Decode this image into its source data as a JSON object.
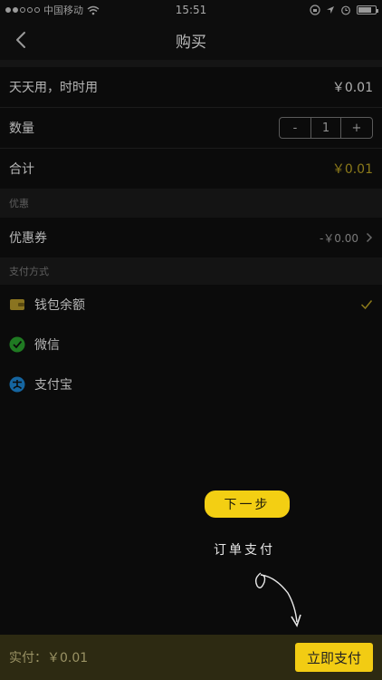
{
  "status_bar": {
    "carrier": "中国移动",
    "time": "15:51"
  },
  "nav": {
    "title": "购买"
  },
  "order": {
    "product_name": "天天用，时时用",
    "product_price": "￥0.01",
    "quantity_label": "数量",
    "quantity_minus": "-",
    "quantity_value": "1",
    "quantity_plus": "+",
    "total_label": "合计",
    "total_price": "￥0.01"
  },
  "discount": {
    "section_label": "优惠",
    "coupon_label": "优惠券",
    "coupon_value": "-￥0.00"
  },
  "payment": {
    "section_label": "支付方式",
    "methods": [
      {
        "label": "钱包余额",
        "icon": "wallet-icon",
        "selected": true
      },
      {
        "label": "微信",
        "icon": "wechat-icon",
        "selected": false
      },
      {
        "label": "支付宝",
        "icon": "alipay-icon",
        "selected": false
      }
    ]
  },
  "guide": {
    "step_label": "下一步",
    "hint_text": "订单支付"
  },
  "bottom_bar": {
    "total_text": "实付：￥0.01",
    "pay_button": "立即支付"
  },
  "colors": {
    "accent": "#f2cc13",
    "background": "#0b0b0b"
  }
}
